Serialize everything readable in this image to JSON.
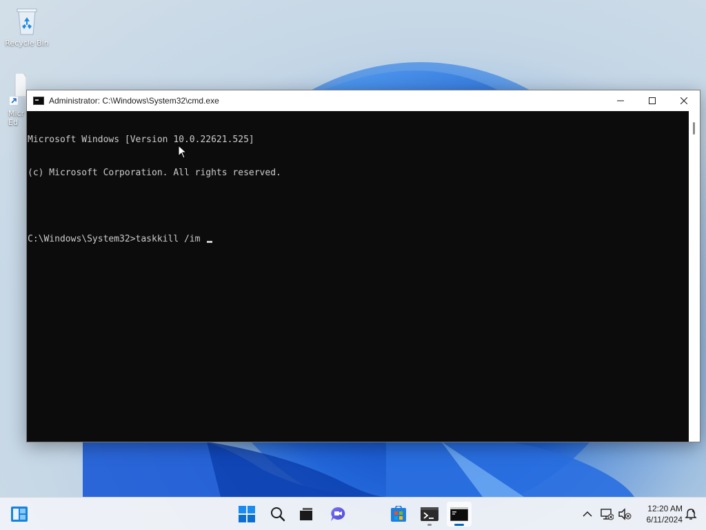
{
  "desktop": {
    "icons": [
      {
        "label": "Recycle Bin"
      },
      {
        "label": "Micr Ed"
      }
    ]
  },
  "window": {
    "title": "Administrator: C:\\Windows\\System32\\cmd.exe",
    "console_lines": [
      "Microsoft Windows [Version 10.0.22621.525]",
      "(c) Microsoft Corporation. All rights reserved.",
      "",
      "C:\\Windows\\System32>taskkill /im "
    ]
  },
  "taskbar": {
    "pinned": [
      {
        "name": "widgets",
        "running": false
      },
      {
        "name": "start",
        "running": false
      },
      {
        "name": "search",
        "running": false
      },
      {
        "name": "task-view",
        "running": false
      },
      {
        "name": "chat",
        "running": false
      },
      {
        "name": "store",
        "running": false
      },
      {
        "name": "terminal",
        "running": true,
        "active": false
      },
      {
        "name": "command-prompt",
        "running": true,
        "active": true
      }
    ],
    "clock": {
      "time": "12:20 AM",
      "date": "6/11/2024"
    }
  },
  "colors": {
    "console_bg": "#0c0c0c",
    "console_fg": "#cccccc",
    "accent": "#0067c0",
    "win_blue": "#0078d4"
  }
}
